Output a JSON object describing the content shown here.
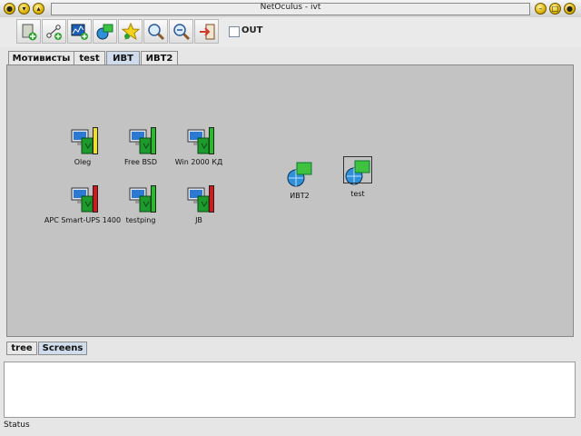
{
  "window": {
    "title": "NetOculus - ivt"
  },
  "toolbar": {
    "buttons": [
      {
        "icon": "add-device-icon"
      },
      {
        "icon": "add-link-icon"
      },
      {
        "icon": "add-chart-icon"
      },
      {
        "icon": "network-icon"
      },
      {
        "icon": "star-icon"
      },
      {
        "icon": "zoom-in-icon"
      },
      {
        "icon": "zoom-out-icon"
      },
      {
        "icon": "exit-icon"
      }
    ],
    "out_label": "OUT"
  },
  "tabs": [
    "Мотивисты",
    "test",
    "ИВТ",
    "ИВТ2"
  ],
  "nodes": [
    {
      "label": "Oleg",
      "status": "yellow"
    },
    {
      "label": "Free BSD",
      "status": "green"
    },
    {
      "label": "Win 2000 КД",
      "status": "green"
    },
    {
      "label": "APC Smart-UPS 1400",
      "status": "red"
    },
    {
      "label": "testping",
      "status": "green"
    },
    {
      "label": "JB",
      "status": "red"
    },
    {
      "label": "ИВТ2",
      "type": "network"
    },
    {
      "label": "test",
      "type": "network"
    }
  ],
  "status_colors": {
    "yellow": "#f0e020",
    "green": "#22c022",
    "red": "#d81818"
  },
  "bottom_tabs": [
    "tree",
    "Screens"
  ],
  "status": "Status"
}
